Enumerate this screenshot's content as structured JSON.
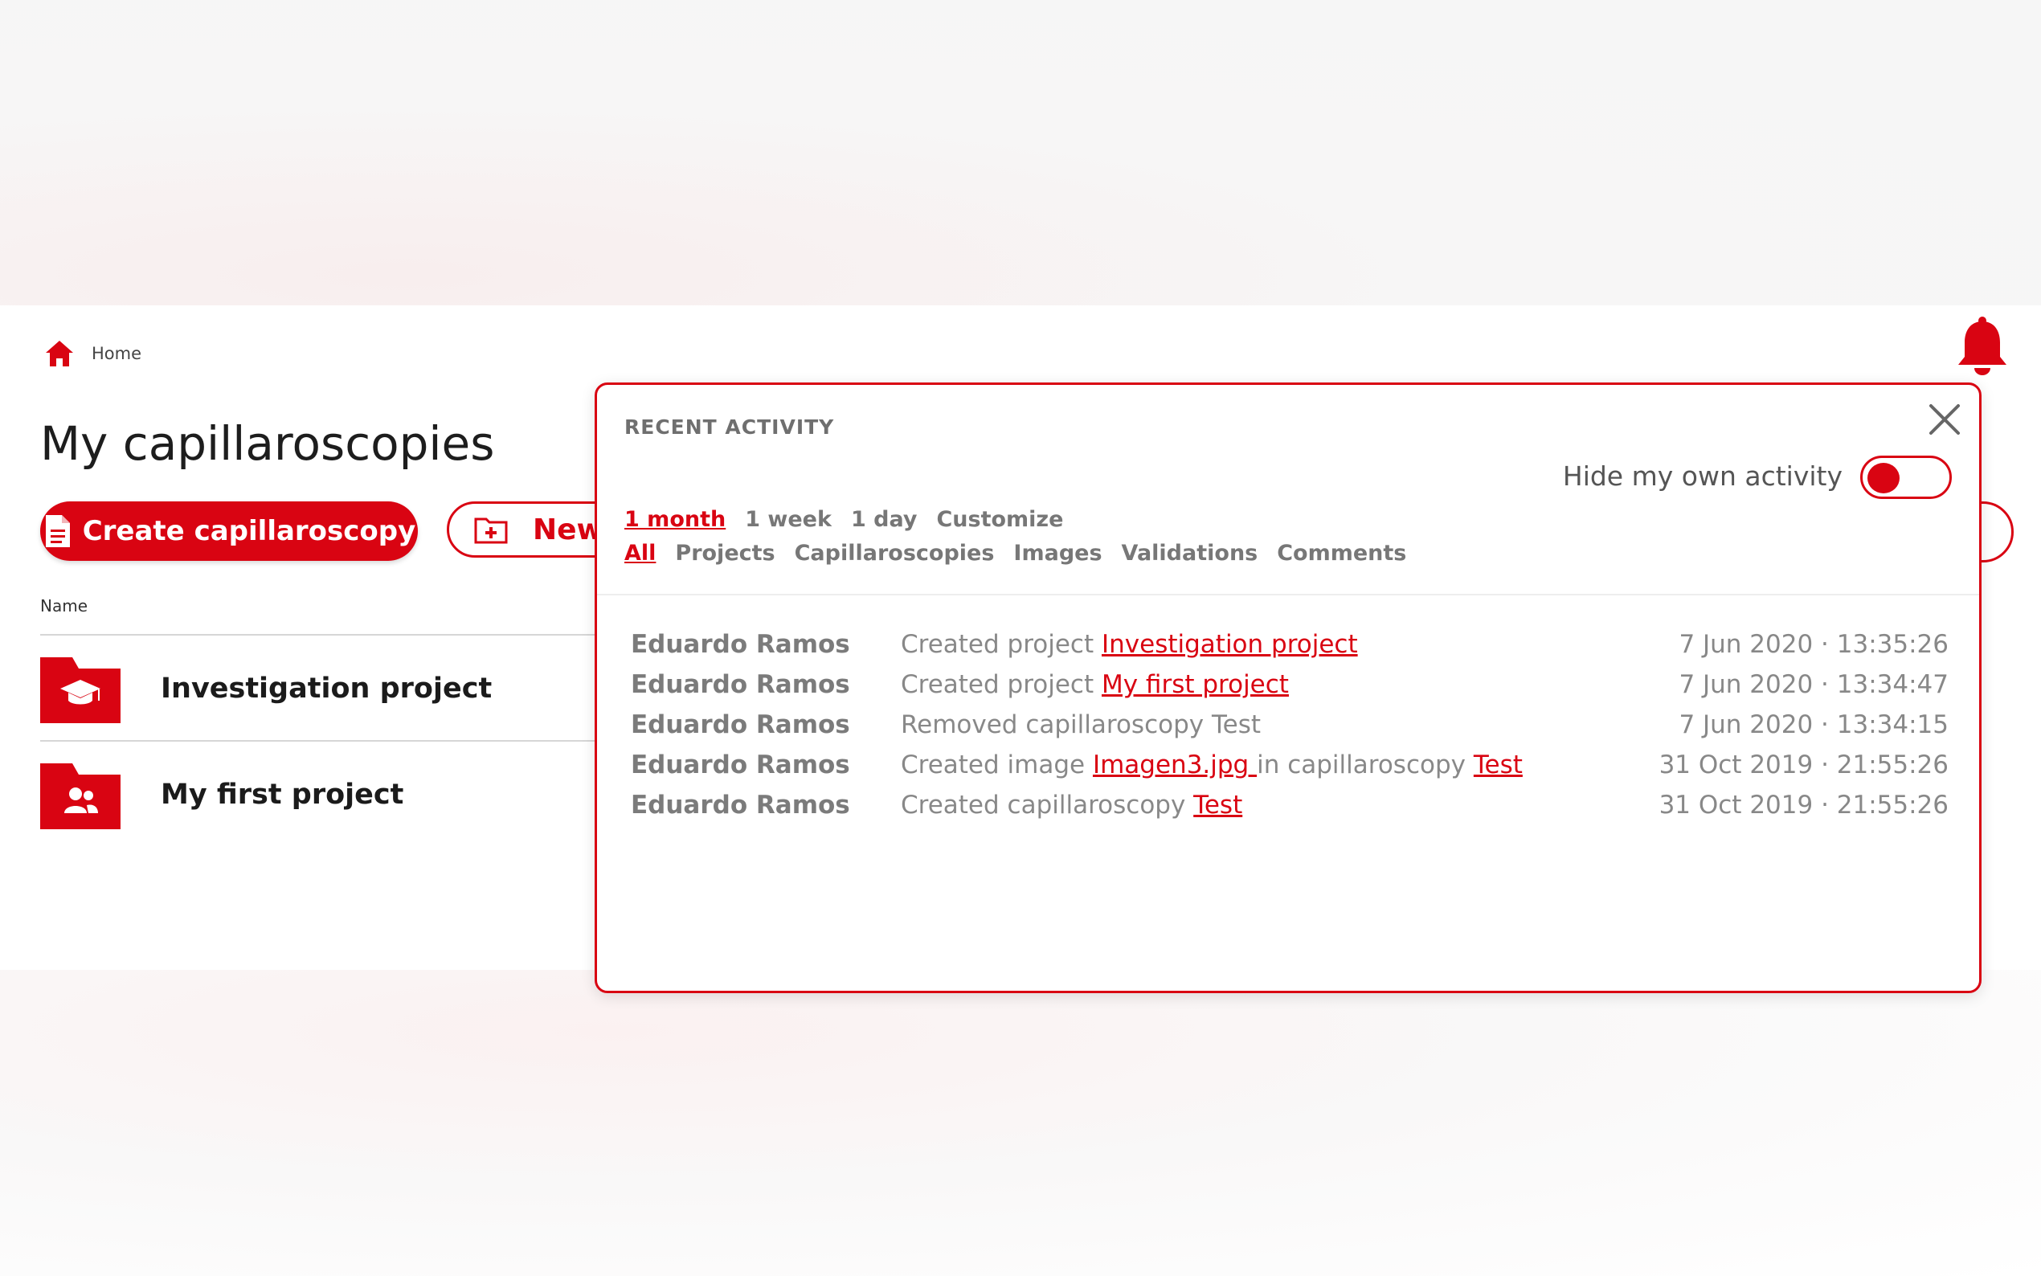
{
  "breadcrumb": {
    "home_label": "Home"
  },
  "page": {
    "title": "My capillaroscopies",
    "create_button": "Create capillaroscopy",
    "new_button": "New",
    "column_name": "Name",
    "projects": [
      {
        "name": "Investigation project",
        "icon": "graduation-cap-icon"
      },
      {
        "name": "My first project",
        "icon": "users-icon"
      }
    ]
  },
  "panel": {
    "title": "RECENT ACTIVITY",
    "hide_own_label": "Hide my own activity",
    "hide_own_enabled": false,
    "time_filters": [
      "1 month",
      "1 week",
      "1 day",
      "Customize"
    ],
    "active_time_filter": "1 month",
    "type_filters": [
      "All",
      "Projects",
      "Capillaroscopies",
      "Images",
      "Validations",
      "Comments"
    ],
    "active_type_filter": "All",
    "activities": [
      {
        "user": "Eduardo Ramos",
        "prefix": "Created project ",
        "link1": "Investigation project",
        "middle": "",
        "link2": "",
        "date": "7 Jun 2020 · 13:35:26"
      },
      {
        "user": "Eduardo Ramos",
        "prefix": "Created project ",
        "link1": "My first project",
        "middle": "",
        "link2": "",
        "date": "7 Jun 2020 · 13:34:47"
      },
      {
        "user": "Eduardo Ramos",
        "prefix": "Removed capillaroscopy Test",
        "link1": "",
        "middle": "",
        "link2": "",
        "date": "7 Jun 2020 · 13:34:15"
      },
      {
        "user": "Eduardo Ramos",
        "prefix": "Created image ",
        "link1": "Imagen3.jpg ",
        "middle": "in capillaroscopy ",
        "link2": "Test",
        "date": "31 Oct 2019 · 21:55:26"
      },
      {
        "user": "Eduardo Ramos",
        "prefix": "Created capillaroscopy ",
        "link1": "Test",
        "middle": "",
        "link2": "",
        "date": "31 Oct 2019 · 21:55:26"
      }
    ]
  },
  "colors": {
    "accent": "#d90412",
    "muted_text": "#888888"
  }
}
